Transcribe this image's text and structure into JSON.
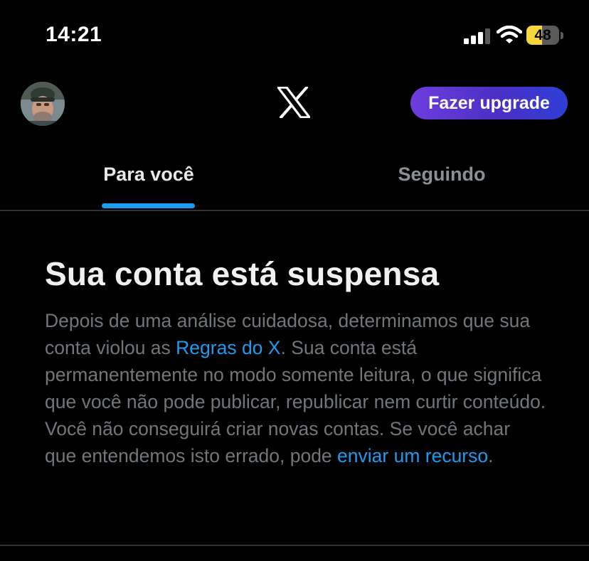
{
  "status_bar": {
    "time": "14:21",
    "battery_level": "48",
    "battery_fraction": 0.48,
    "icons": [
      "signal-icon",
      "wifi-icon",
      "battery-icon"
    ]
  },
  "header": {
    "logo": "x-logo-icon",
    "upgrade_label": "Fazer upgrade",
    "upgrade_gradient": [
      "#6e3dde",
      "#2e3fd6"
    ]
  },
  "tabs": [
    {
      "label": "Para você",
      "active": true
    },
    {
      "label": "Seguindo",
      "active": false
    }
  ],
  "notice": {
    "title": "Sua conta está suspensa",
    "body_part1": "Depois de uma análise cuidadosa, determinamos que sua conta violou as ",
    "rules_link": "Regras do X",
    "body_part2": ". Sua conta está permanentemente no modo somente leitura, o que significa que você não pode publicar, republicar nem curtir conteúdo. Você não conseguirá criar novas contas. Se você achar que entendemos isto errado, pode ",
    "appeal_link": "enviar um recurso",
    "body_part3": "."
  },
  "colors": {
    "background": "#000000",
    "accent": "#1d9bf0",
    "muted_text": "#71767b",
    "divider": "#2f3336"
  }
}
